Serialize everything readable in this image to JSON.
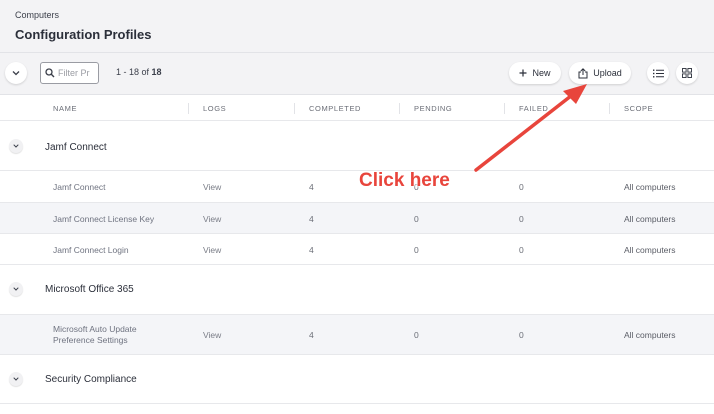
{
  "header": {
    "breadcrumb": "Computers",
    "title": "Configuration Profiles"
  },
  "toolbar": {
    "filter_placeholder": "Filter Pr",
    "count_range": "1 - 18 of",
    "count_total": "18",
    "new_label": "New",
    "upload_label": "Upload"
  },
  "columns": {
    "name": "NAME",
    "logs": "LOGS",
    "completed": "COMPLETED",
    "pending": "PENDING",
    "failed": "FAILED",
    "scope": "SCOPE"
  },
  "groups": [
    {
      "name": "Jamf Connect",
      "rows": [
        {
          "name": "Jamf Connect",
          "logs": "View",
          "completed": "4",
          "pending": "0",
          "failed": "0",
          "scope": "All computers"
        },
        {
          "name": "Jamf Connect License Key",
          "logs": "View",
          "completed": "4",
          "pending": "0",
          "failed": "0",
          "scope": "All computers"
        },
        {
          "name": "Jamf Connect Login",
          "logs": "View",
          "completed": "4",
          "pending": "0",
          "failed": "0",
          "scope": "All computers"
        }
      ]
    },
    {
      "name": "Microsoft Office 365",
      "rows": [
        {
          "name_line1": "Microsoft Auto Update",
          "name_line2": "Preference Settings",
          "logs": "View",
          "completed": "4",
          "pending": "0",
          "failed": "0",
          "scope": "All computers"
        }
      ]
    },
    {
      "name": "Security Compliance",
      "rows": []
    }
  ],
  "annotation": {
    "text": "Click here",
    "color": "#e8453c"
  },
  "icons": {
    "collapse": "chevron-down-icon",
    "search": "search-icon",
    "new": "plus-icon",
    "upload": "upload-icon",
    "list_view": "list-icon",
    "grid_view": "grid-icon"
  }
}
